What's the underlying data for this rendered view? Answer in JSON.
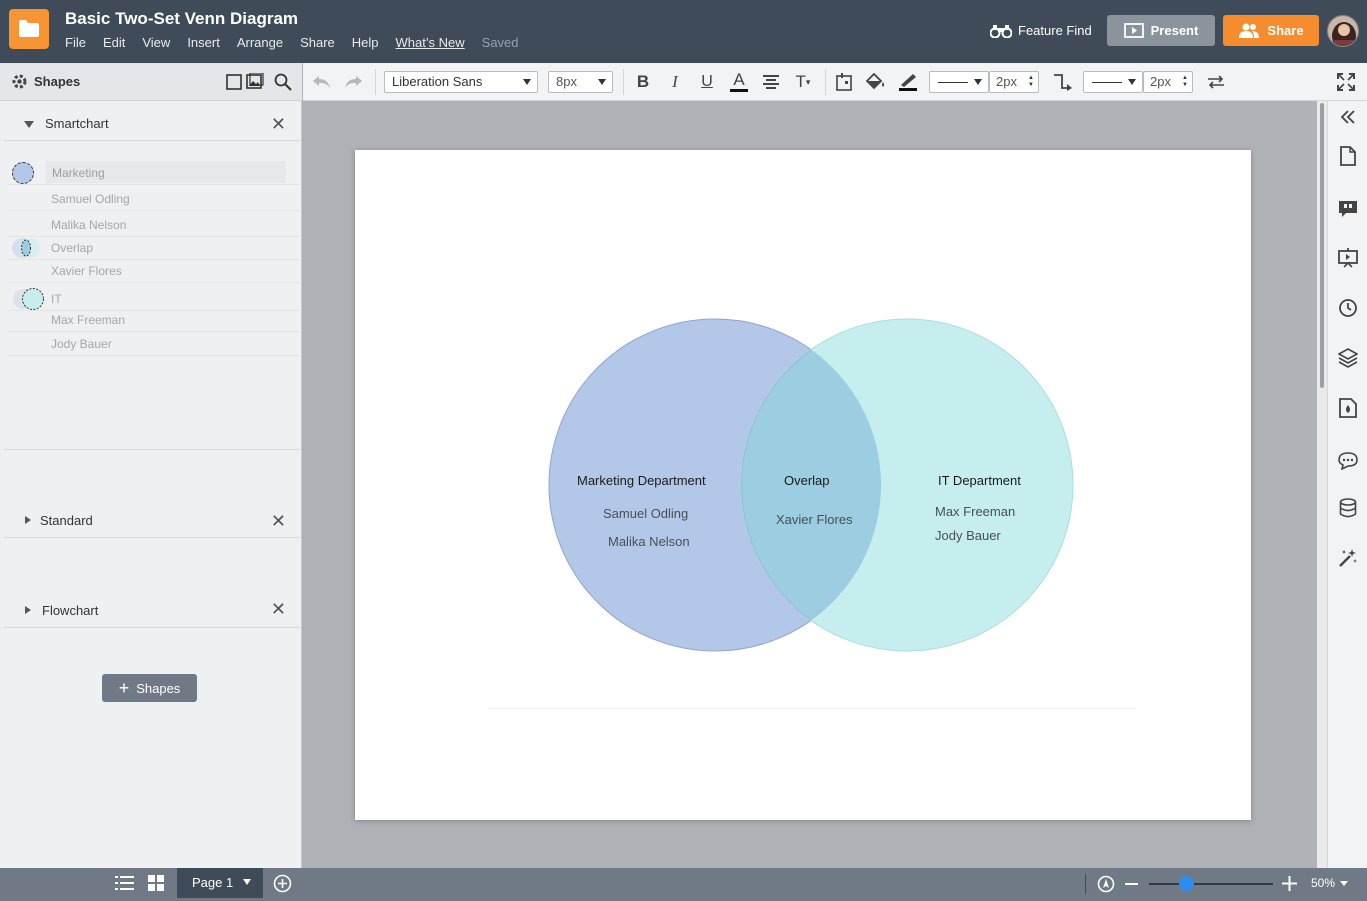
{
  "header": {
    "title": "Basic Two-Set Venn Diagram",
    "menu": [
      "File",
      "Edit",
      "View",
      "Insert",
      "Arrange",
      "Share",
      "Help",
      "What’s New"
    ],
    "saved_status": "Saved",
    "feature_find": "Feature Find",
    "present_label": "Present",
    "share_label": "Share",
    "brand_color": "#f79433"
  },
  "toolbar": {
    "font_family": "Liberation Sans",
    "font_size": "8px",
    "line_width_1": "2px",
    "line_width_2": "2px"
  },
  "left_panel": {
    "title": "Shapes",
    "smartchart": {
      "label": "Smartchart",
      "rows": [
        {
          "text": "Marketing",
          "color": "#b3c8e8"
        },
        {
          "text": "Samuel Odling"
        },
        {
          "text": "Malika Nelson"
        },
        {
          "text": "Overlap",
          "color": "#9ccde0"
        },
        {
          "text": "Xavier Flores"
        },
        {
          "text": "IT",
          "color": "#c6eeee"
        },
        {
          "text": "Max Freeman"
        },
        {
          "text": "Jody Bauer"
        }
      ]
    },
    "standard_label": "Standard",
    "flowchart_label": "Flowchart",
    "add_shapes_label": "Shapes"
  },
  "diagram": {
    "left": {
      "title": "Marketing Department",
      "members": [
        "Samuel Odling",
        "Malika Nelson"
      ],
      "fill": "#b3c8e8",
      "stroke": "#8fa6cc"
    },
    "overlap": {
      "title": "Overlap",
      "members": [
        "Xavier Flores"
      ],
      "fill": "#9ccde0"
    },
    "right": {
      "title": "IT Department",
      "members": [
        "Max Freeman",
        "Jody Bauer"
      ],
      "fill": "#c6eeee",
      "stroke": "#a9dede"
    }
  },
  "bottom": {
    "page_label": "Page 1",
    "zoom": "50%",
    "zoom_slider_fraction": 0.3
  }
}
